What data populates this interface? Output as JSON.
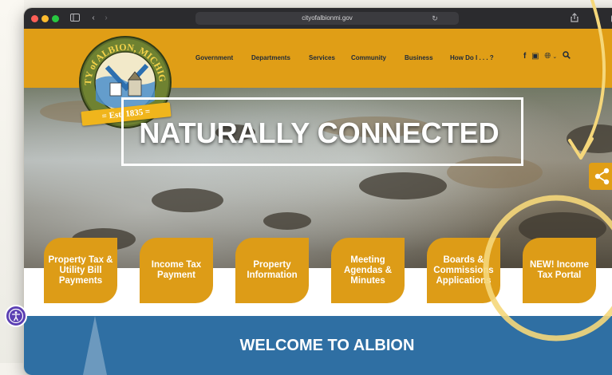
{
  "browser": {
    "url": "cityofalbionmi.gov"
  },
  "nav": {
    "items": [
      "Government",
      "Departments",
      "Services",
      "Community",
      "Business",
      "How Do I . . . ?"
    ]
  },
  "logo": {
    "text_arc": "CITY of ALBION, MICHIGAN",
    "est": "= Est. 1835 ="
  },
  "hero": {
    "tagline": "NATURALLY CONNECTED"
  },
  "quick_links": [
    "Property Tax & Utility Bill Payments",
    "Income Tax Payment",
    "Property Information",
    "Meeting Agendas & Minutes",
    "Boards & Commissions Applications",
    "NEW! Income Tax Portal"
  ],
  "welcome": {
    "title": "WELCOME TO ALBION"
  },
  "colors": {
    "brand_gold": "#e09e16",
    "nav_text": "#1e2a3a",
    "welcome_blue": "#2f6fa3",
    "highlight_yellow": "#f5d77a",
    "a11y_purple": "#5b3fb3"
  },
  "icons": {
    "header": [
      "facebook-icon",
      "youtube-icon",
      "globe-icon",
      "chevron-down-icon",
      "search-icon"
    ],
    "browser": [
      "sidebar-icon",
      "back-icon",
      "forward-icon",
      "reload-icon",
      "share-icon",
      "tabs-icon"
    ],
    "page": [
      "share-network-icon",
      "accessibility-icon"
    ]
  }
}
